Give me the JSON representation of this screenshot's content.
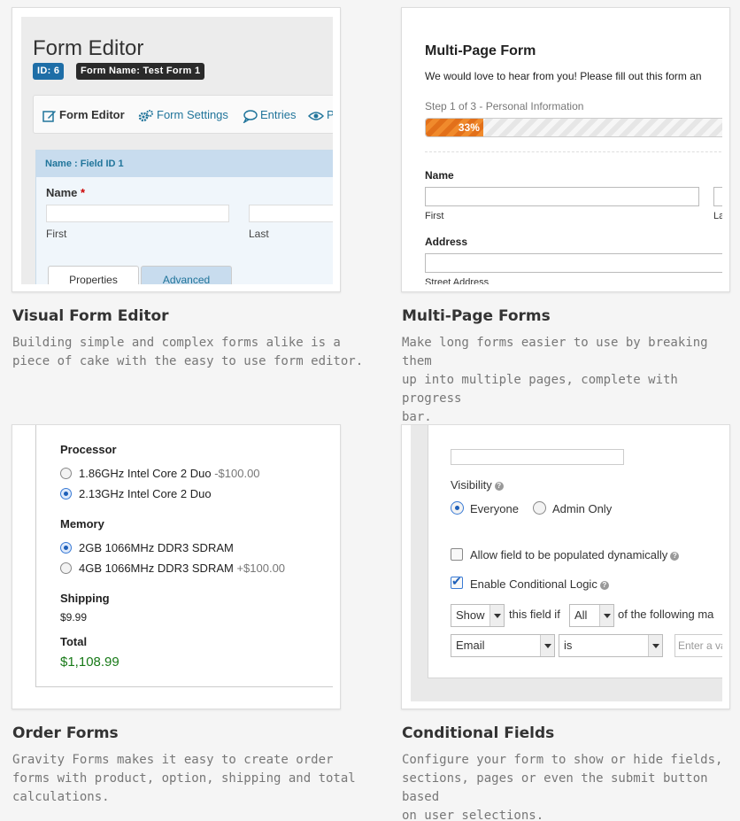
{
  "features": [
    {
      "title": "Visual Form Editor",
      "desc_lines": [
        "Building simple and complex forms alike is a",
        "piece of cake with the easy to use form editor."
      ]
    },
    {
      "title": "Multi-Page Forms",
      "desc_lines": [
        "Make long forms easier to use by breaking them",
        "up into multiple pages, complete with progress",
        "bar."
      ]
    },
    {
      "title": "Order Forms",
      "desc_lines": [
        "Gravity Forms makes it easy to create order",
        "forms with product, option, shipping and total",
        "calculations."
      ]
    },
    {
      "title": "Conditional Fields",
      "desc_lines": [
        "Configure your form to show or hide fields,",
        "sections, pages or even the submit button based",
        "on user selections."
      ]
    }
  ],
  "editor": {
    "title": "Form Editor",
    "id_badge": "ID: 6",
    "name_badge": "Form Name: Test Form 1",
    "toolbar": [
      "Form Editor",
      "Form Settings",
      "Entries",
      "P"
    ],
    "field_head": "Name : Field ID 1",
    "field_label": "Name",
    "required_mark": "*",
    "sub_first": "First",
    "sub_last": "Last",
    "tab_properties": "Properties",
    "tab_advanced": "Advanced"
  },
  "multipage": {
    "title": "Multi-Page Form",
    "intro": "We would love to hear from you! Please fill out this form an",
    "step": "Step 1 of 3 - Personal Information",
    "progress_percent": 33,
    "progress_label": "33%",
    "name_label": "Name",
    "first_label": "First",
    "last_label_fragment": "La",
    "address_label": "Address",
    "street_label": "Street Address"
  },
  "order": {
    "processor_label": "Processor",
    "processor_options": [
      {
        "label": "1.86GHz Intel Core 2 Duo",
        "price": "-$100.00",
        "selected": false
      },
      {
        "label": "2.13GHz Intel Core 2 Duo",
        "price": "",
        "selected": true
      }
    ],
    "memory_label": "Memory",
    "memory_options": [
      {
        "label": "2GB 1066MHz DDR3 SDRAM",
        "price": "",
        "selected": true
      },
      {
        "label": "4GB 1066MHz DDR3 SDRAM",
        "price": "+$100.00",
        "selected": false
      }
    ],
    "shipping_label": "Shipping",
    "shipping_value": "$9.99",
    "total_label": "Total",
    "total_value": "$1,108.99"
  },
  "conditional": {
    "visibility_label": "Visibility",
    "visibility_options": [
      {
        "label": "Everyone",
        "selected": true
      },
      {
        "label": "Admin Only",
        "selected": false
      }
    ],
    "allow_dynamic": "Allow field to be populated dynamically",
    "allow_dynamic_checked": false,
    "enable_logic": "Enable Conditional Logic",
    "enable_logic_checked": true,
    "action_select": "Show",
    "this_field_if": "this field if",
    "match_select": "All",
    "of_following": "of the following ma",
    "rule_field": "Email",
    "rule_operator": "is",
    "rule_value_placeholder": "Enter a valu"
  },
  "colors": {
    "accent_blue": "#21759b",
    "progress_orange": "#e2701a",
    "total_green": "#187a18",
    "required_red": "#cc0000"
  }
}
